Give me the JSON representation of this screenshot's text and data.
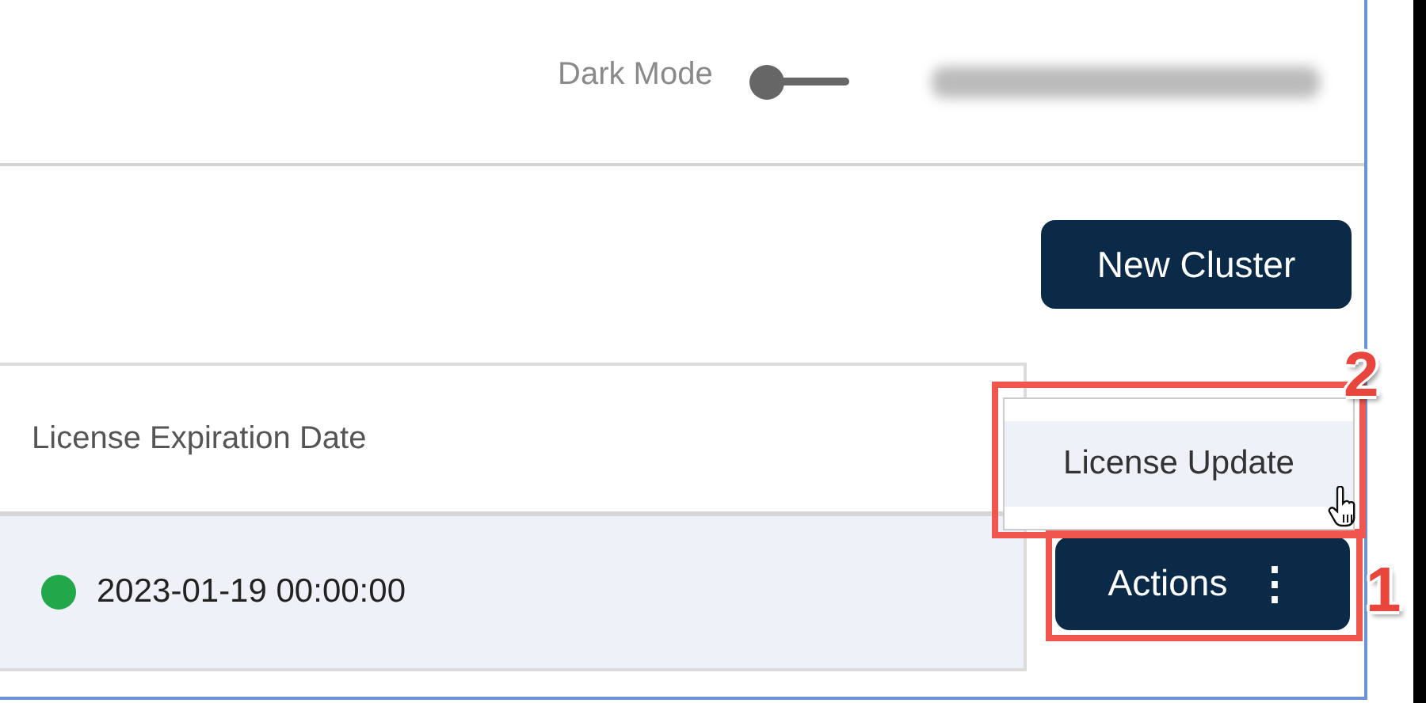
{
  "header": {
    "dark_mode_label": "Dark Mode",
    "dark_mode_on": false
  },
  "toolbar": {
    "new_cluster_button": "New Cluster"
  },
  "table": {
    "columns": [
      "License Expiration Date"
    ],
    "rows": [
      {
        "color": "#22a84a",
        "license_expiration_date": "2023-01-19 00:00:00",
        "actions_button": "Actions",
        "actions_icon": "⋮",
        "annotation": "1"
      }
    ]
  },
  "menu": {
    "items": [
      {
        "label": "License Update",
        "hovered": true
      }
    ],
    "annotation": "2"
  }
}
